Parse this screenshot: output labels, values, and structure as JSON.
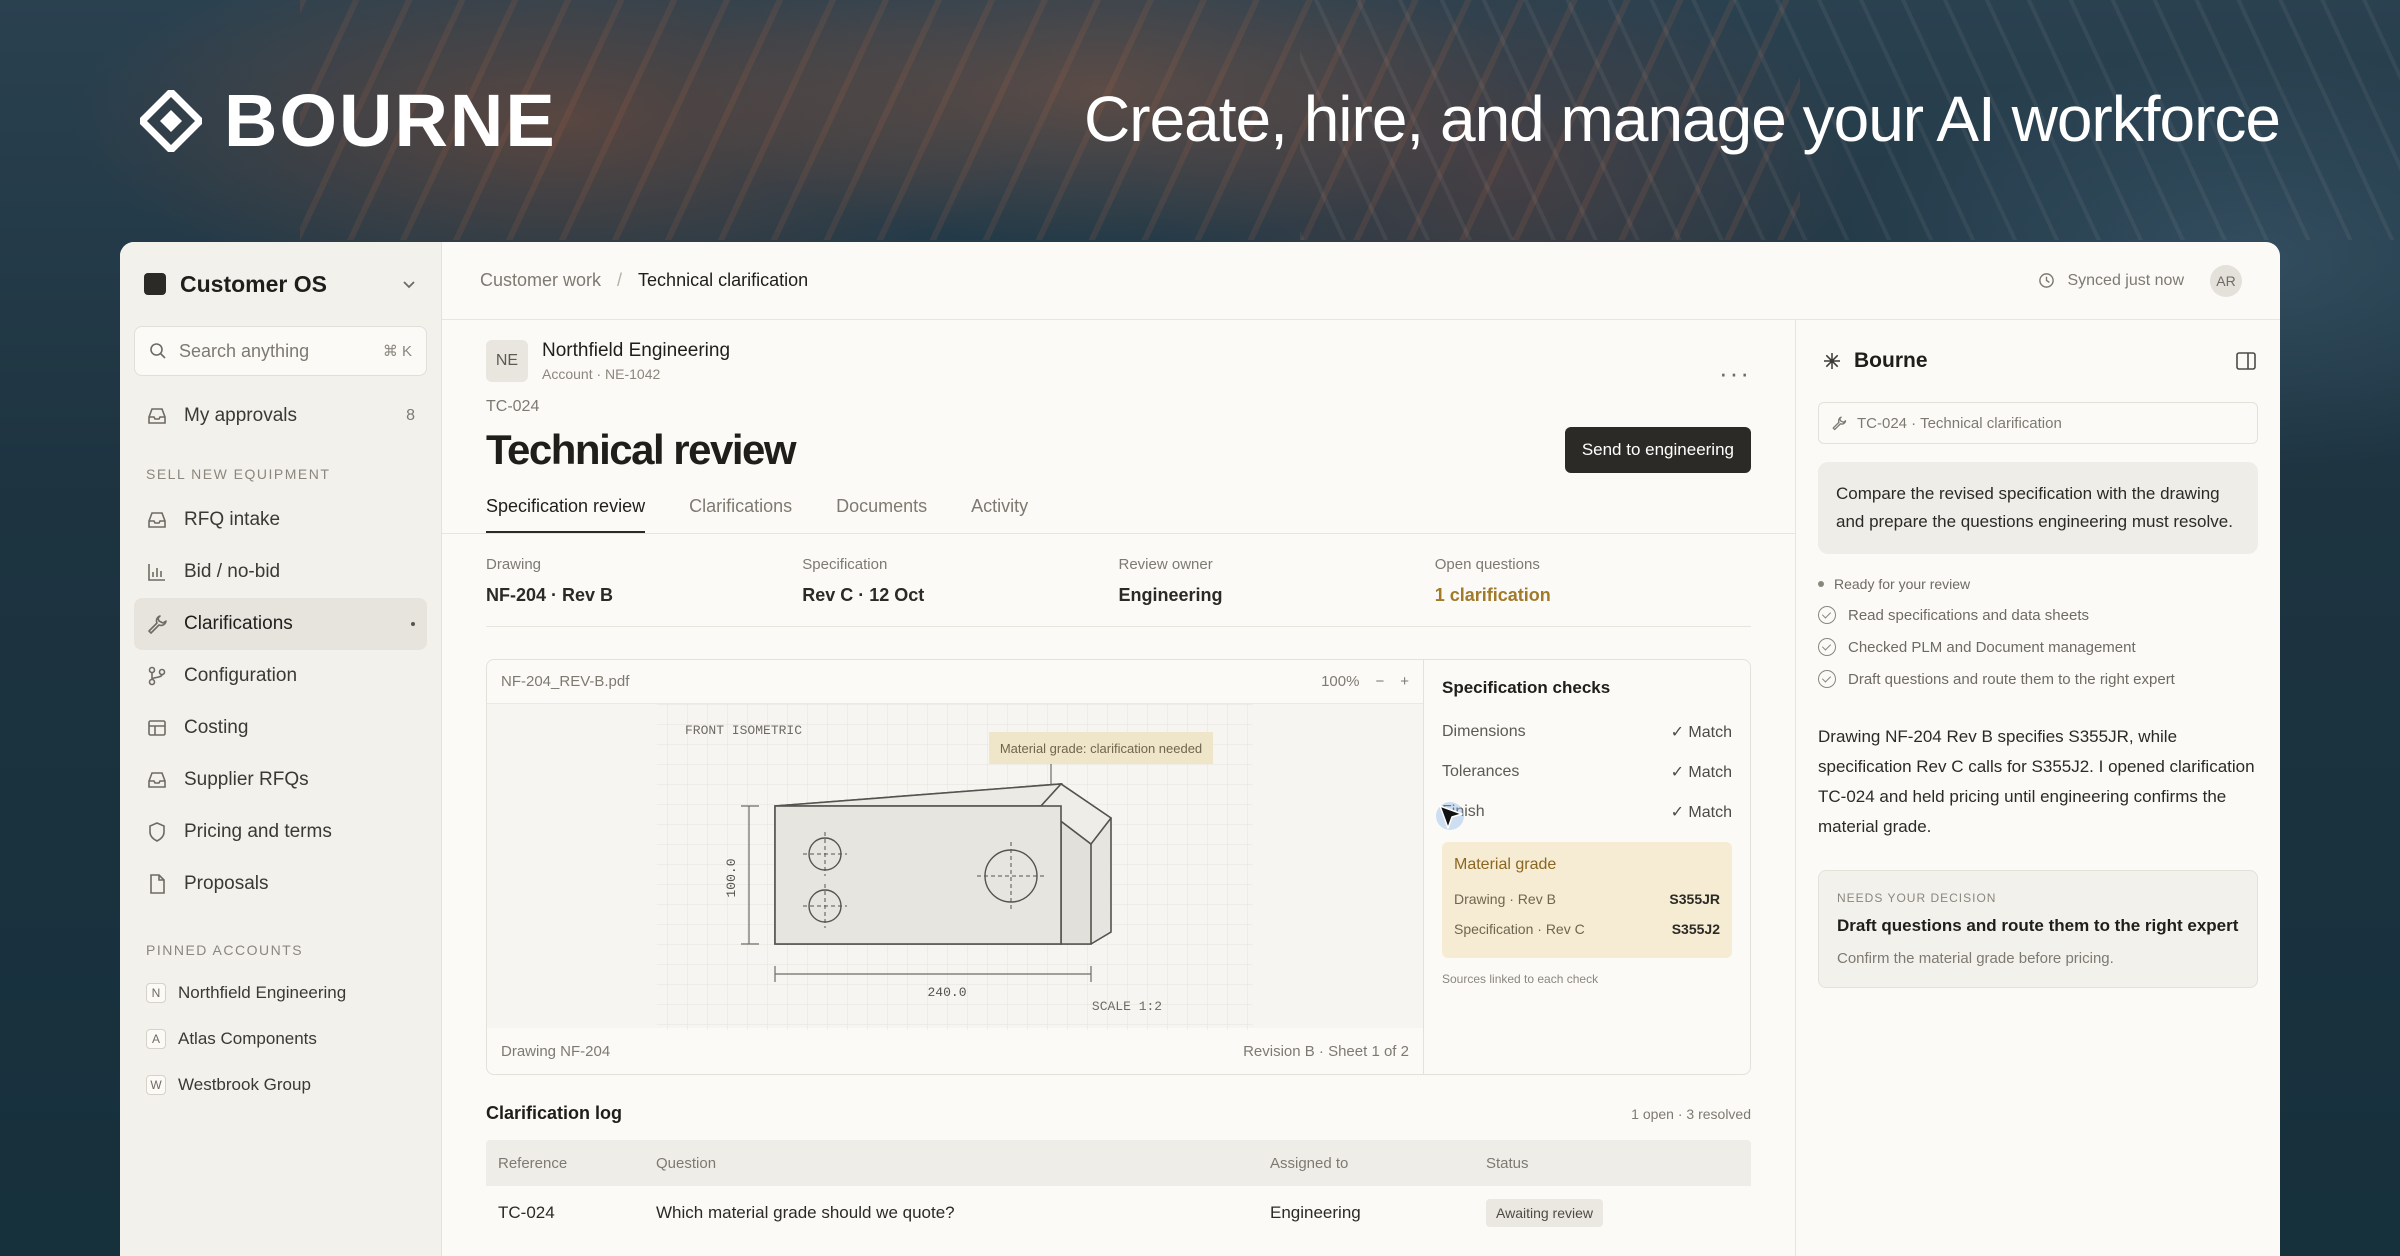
{
  "hero": {
    "brand": "BOURNE",
    "tagline": "Create, hire, and manage your AI workforce"
  },
  "sidebar": {
    "workspace": "Customer OS",
    "search_placeholder": "Search anything",
    "search_shortcut": "⌘ K",
    "approvals": {
      "label": "My approvals",
      "count": "8"
    },
    "section_label": "SELL NEW EQUIPMENT",
    "items": [
      {
        "label": "RFQ intake",
        "icon": "inbox-icon"
      },
      {
        "label": "Bid / no-bid",
        "icon": "bar-chart-icon"
      },
      {
        "label": "Clarifications",
        "icon": "wrench-icon",
        "active": true
      },
      {
        "label": "Configuration",
        "icon": "branch-icon"
      },
      {
        "label": "Costing",
        "icon": "table-icon"
      },
      {
        "label": "Supplier RFQs",
        "icon": "inbox-icon"
      },
      {
        "label": "Pricing and terms",
        "icon": "shield-icon"
      },
      {
        "label": "Proposals",
        "icon": "document-icon"
      }
    ],
    "pinned_label": "PINNED ACCOUNTS",
    "pinned": [
      {
        "initial": "N",
        "name": "Northfield Engineering"
      },
      {
        "initial": "A",
        "name": "Atlas Components"
      },
      {
        "initial": "W",
        "name": "Westbrook Group"
      }
    ]
  },
  "topbar": {
    "crumb_parent": "Customer work",
    "crumb_current": "Technical clarification",
    "sync": "Synced just now",
    "avatar": "AR"
  },
  "account": {
    "initials": "NE",
    "name": "Northfield Engineering",
    "sub": "Account · NE-1042"
  },
  "ticket": {
    "id": "TC-024",
    "title": "Technical review",
    "primary_action": "Send to engineering"
  },
  "tabs": [
    "Specification review",
    "Clarifications",
    "Documents",
    "Activity"
  ],
  "meta": [
    {
      "label": "Drawing",
      "value": "NF-204 · Rev B"
    },
    {
      "label": "Specification",
      "value": "Rev C · 12 Oct"
    },
    {
      "label": "Review owner",
      "value": "Engineering"
    },
    {
      "label": "Open questions",
      "value": "1 clarification"
    }
  ],
  "viewer": {
    "file": "NF-204_REV-B.pdf",
    "zoom": "100%",
    "zoom_out": "−",
    "zoom_in": "+",
    "view_label": "FRONT ISOMETRIC",
    "callout": "Material grade: clarification needed",
    "dim_height": "100.0",
    "dim_width": "240.0",
    "scale": "SCALE 1:2",
    "footer_left": "Drawing NF-204",
    "footer_right": "Revision B · Sheet 1 of 2"
  },
  "checks": {
    "title": "Specification checks",
    "rows": [
      {
        "label": "Dimensions",
        "status": "✓ Match"
      },
      {
        "label": "Tolerances",
        "status": "✓ Match"
      },
      {
        "label": "Finish",
        "status": "✓ Match"
      }
    ],
    "grade": {
      "title": "Material grade",
      "rows": [
        {
          "label": "Drawing · Rev B",
          "value": "S355JR"
        },
        {
          "label": "Specification · Rev C",
          "value": "S355J2"
        }
      ]
    },
    "note": "Sources linked to each check"
  },
  "log": {
    "title": "Clarification log",
    "summary": "1 open · 3 resolved",
    "columns": [
      "Reference",
      "Question",
      "Assigned to",
      "Status"
    ],
    "rows": [
      {
        "ref": "TC-024",
        "question": "Which material grade should we quote?",
        "assignee": "Engineering",
        "status": "Awaiting review"
      }
    ]
  },
  "assistant": {
    "title": "Bourne",
    "context": "TC-024 · Technical clarification",
    "prompt": "Compare the revised specification with the drawing and prepare the questions engineering must resolve.",
    "ready": "Ready for your review",
    "steps": [
      "Read specifications and data sheets",
      "Checked PLM and Document management",
      "Draft questions and route them to the right expert"
    ],
    "answer": "Drawing NF-204 Rev B specifies S355JR, while specification Rev C calls for S355J2. I opened clarification TC-024 and held pricing until engineering confirms the material grade.",
    "decision": {
      "label": "NEEDS YOUR DECISION",
      "title": "Draft questions and route them to the right expert",
      "sub": "Confirm the material grade before pricing."
    }
  },
  "colors": {
    "accent": "#a17a2a",
    "grade_bg": "#f6ecd3",
    "primary_btn": "#2b2a26"
  }
}
